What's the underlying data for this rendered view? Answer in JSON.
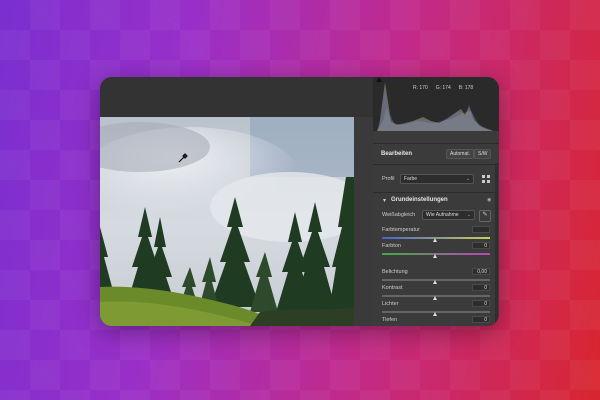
{
  "histogram": {
    "r": "R: 170",
    "g": "G: 174",
    "b": "B: 178"
  },
  "edit": {
    "title": "Bearbeiten",
    "auto_label": "Automat.",
    "sw_label": "S/W"
  },
  "profile": {
    "label": "Profil",
    "value": "Farbe"
  },
  "basic": {
    "title": "Grundeinstellungen"
  },
  "white_balance": {
    "label": "Weißabgleich",
    "value": "Wie Aufnahme"
  },
  "sliders": [
    {
      "label": "Farbtemperatur",
      "value": "",
      "level": 0.5
    },
    {
      "label": "Farbton",
      "value": "0",
      "level": 0.5
    },
    {
      "label": "Belichtung",
      "value": "0,00",
      "level": 0.5
    },
    {
      "label": "Kontrast",
      "value": "0",
      "level": 0.5
    },
    {
      "label": "Lichter",
      "value": "0",
      "level": 0.5
    },
    {
      "label": "Tiefen",
      "value": "0",
      "level": 0.5
    }
  ],
  "icons": {
    "dropper": "eyedropper-icon",
    "grid": "profile-browser-icon",
    "collapse": "chevron-down-icon",
    "visibility": "eye-icon",
    "cursor": "cursor-icon"
  },
  "colors": {
    "panel": "#3b3b3b",
    "histogram_bg": "#2a2a2a"
  }
}
